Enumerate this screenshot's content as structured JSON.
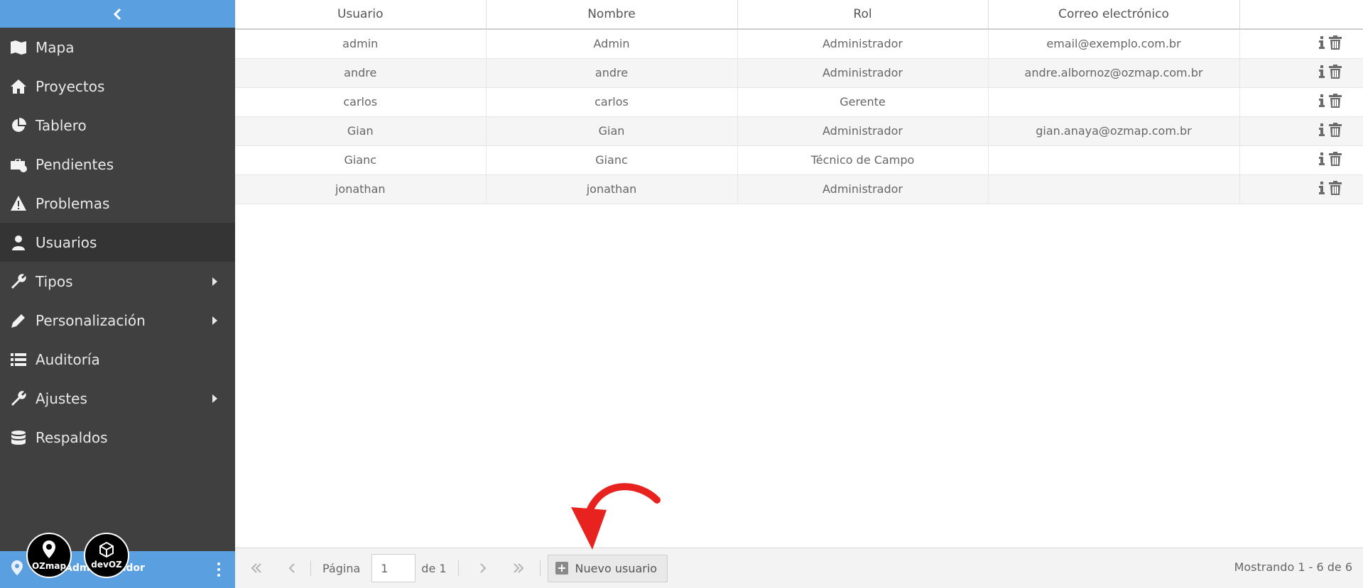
{
  "sidebar": {
    "collapse_icon": "chevron-left-icon",
    "items": [
      {
        "label": "Mapa",
        "icon": "map-icon"
      },
      {
        "label": "Proyectos",
        "icon": "home-icon"
      },
      {
        "label": "Tablero",
        "icon": "pie-chart-icon"
      },
      {
        "label": "Pendientes",
        "icon": "briefcase-clock-icon"
      },
      {
        "label": "Problemas",
        "icon": "warning-icon"
      },
      {
        "label": "Usuarios",
        "icon": "user-icon",
        "active": true
      },
      {
        "label": "Tipos",
        "icon": "wrench-icon",
        "submenu": true
      },
      {
        "label": "Personalización",
        "icon": "pencil-icon",
        "submenu": true
      },
      {
        "label": "Auditoría",
        "icon": "list-icon"
      },
      {
        "label": "Ajustes",
        "icon": "wrench-icon",
        "submenu": true
      },
      {
        "label": "Respaldos",
        "icon": "database-icon"
      }
    ],
    "footer": {
      "user_label": "Administrador",
      "logos": [
        "OZmap",
        "devOZ"
      ]
    }
  },
  "table": {
    "columns": [
      "Usuario",
      "Nombre",
      "Rol",
      "Correo electrónico"
    ],
    "rows": [
      [
        "admin",
        "Admin",
        "Administrador",
        "email@exemplo.com.br"
      ],
      [
        "andre",
        "andre",
        "Administrador",
        "andre.albornoz@ozmap.com.br"
      ],
      [
        "carlos",
        "carlos",
        "Gerente",
        ""
      ],
      [
        "Gian",
        "Gian",
        "Administrador",
        "gian.anaya@ozmap.com.br"
      ],
      [
        "Gianc",
        "Gianc",
        "Técnico de Campo",
        ""
      ],
      [
        "jonathan",
        "jonathan",
        "Administrador",
        ""
      ]
    ],
    "row_actions": [
      "info-icon",
      "trash-icon"
    ]
  },
  "toolbar": {
    "page_label": "Página",
    "page_value": "1",
    "of_label": "de 1",
    "new_user_label": "Nuevo usuario",
    "status": "Mostrando 1 - 6 de 6"
  },
  "colors": {
    "sidebar_bg": "#404040",
    "accent": "#5a9fe0",
    "annotation_arrow": "#e8221f"
  }
}
